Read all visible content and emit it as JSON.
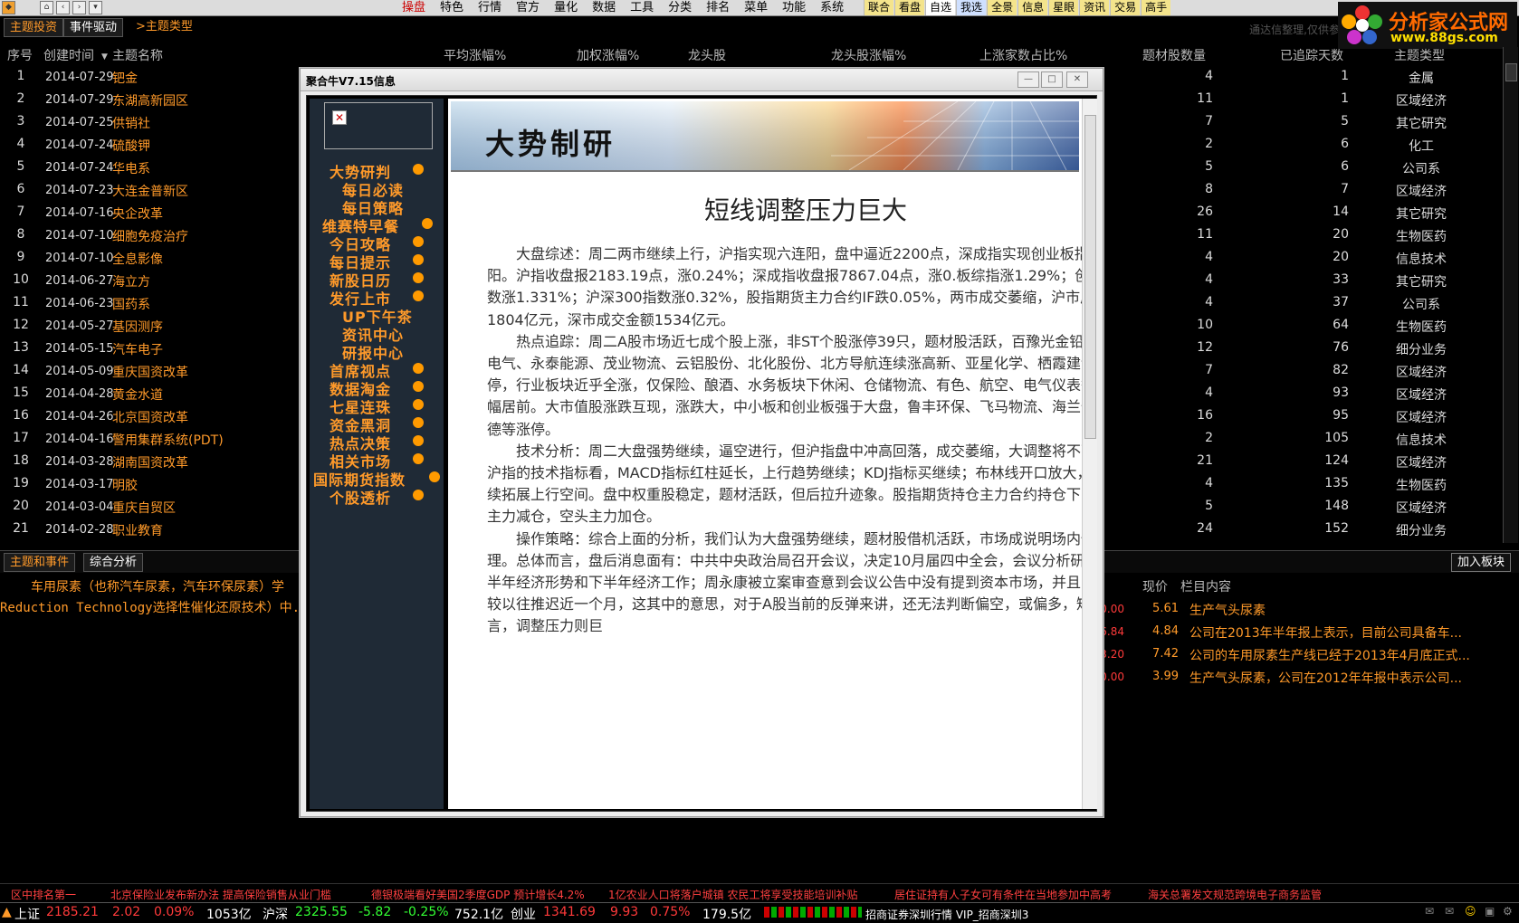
{
  "menubar": {
    "items": [
      "操盘",
      "特色",
      "行情",
      "官方",
      "量化",
      "数据",
      "工具",
      "分类",
      "排名",
      "菜单",
      "功能",
      "系统"
    ],
    "tools": [
      "联合",
      "看盘",
      "自选",
      "我选",
      "全景",
      "信息",
      "星眼",
      "资讯",
      "交易",
      "高手"
    ]
  },
  "subtabs": {
    "tab1": "主题投资",
    "tab2": "事件驱动",
    "link": ">主题类型",
    "source_note": "通达信整理,仅供参考（右键"
  },
  "logo": {
    "title": "分析家公式网",
    "url": "www.88gs.com"
  },
  "table": {
    "headers": [
      "序号",
      "创建时间",
      "主题名称",
      "平均涨幅%",
      "加权涨幅%",
      "龙头股",
      "龙头股涨幅%",
      "上涨家数占比%",
      "题材股数量",
      "已追踪天数",
      "主题类型"
    ],
    "rows": [
      {
        "idx": "1",
        "date": "2014-07-29",
        "name": "钯金",
        "count": "4",
        "days": "1",
        "type": "金属"
      },
      {
        "idx": "2",
        "date": "2014-07-29",
        "name": "东湖高新园区",
        "count": "11",
        "days": "1",
        "type": "区域经济"
      },
      {
        "idx": "3",
        "date": "2014-07-25",
        "name": "供销社",
        "count": "7",
        "days": "5",
        "type": "其它研究"
      },
      {
        "idx": "4",
        "date": "2014-07-24",
        "name": "硫酸钾",
        "count": "2",
        "days": "6",
        "type": "化工"
      },
      {
        "idx": "5",
        "date": "2014-07-24",
        "name": "华电系",
        "count": "5",
        "days": "6",
        "type": "公司系"
      },
      {
        "idx": "6",
        "date": "2014-07-23",
        "name": "大连金普新区",
        "count": "8",
        "days": "7",
        "type": "区域经济"
      },
      {
        "idx": "7",
        "date": "2014-07-16",
        "name": "央企改革",
        "count": "26",
        "days": "14",
        "type": "其它研究"
      },
      {
        "idx": "8",
        "date": "2014-07-10",
        "name": "细胞免疫治疗",
        "count": "11",
        "days": "20",
        "type": "生物医药"
      },
      {
        "idx": "9",
        "date": "2014-07-10",
        "name": "全息影像",
        "count": "4",
        "days": "20",
        "type": "信息技术"
      },
      {
        "idx": "10",
        "date": "2014-06-27",
        "name": "海立方",
        "count": "4",
        "days": "33",
        "type": "其它研究"
      },
      {
        "idx": "11",
        "date": "2014-06-23",
        "name": "国药系",
        "count": "4",
        "days": "37",
        "type": "公司系"
      },
      {
        "idx": "12",
        "date": "2014-05-27",
        "name": "基因测序",
        "count": "10",
        "days": "64",
        "type": "生物医药"
      },
      {
        "idx": "13",
        "date": "2014-05-15",
        "name": "汽车电子",
        "count": "12",
        "days": "76",
        "type": "细分业务"
      },
      {
        "idx": "14",
        "date": "2014-05-09",
        "name": "重庆国资改革",
        "count": "7",
        "days": "82",
        "type": "区域经济"
      },
      {
        "idx": "15",
        "date": "2014-04-28",
        "name": "黄金水道",
        "count": "4",
        "days": "93",
        "type": "区域经济"
      },
      {
        "idx": "16",
        "date": "2014-04-26",
        "name": "北京国资改革",
        "count": "16",
        "days": "95",
        "type": "区域经济"
      },
      {
        "idx": "17",
        "date": "2014-04-16",
        "name": "警用集群系统(PDT)",
        "count": "2",
        "days": "105",
        "type": "信息技术"
      },
      {
        "idx": "18",
        "date": "2014-03-28",
        "name": "湖南国资改革",
        "count": "21",
        "days": "124",
        "type": "区域经济"
      },
      {
        "idx": "19",
        "date": "2014-03-17",
        "name": "明胶",
        "count": "4",
        "days": "135",
        "type": "生物医药"
      },
      {
        "idx": "20",
        "date": "2014-03-04",
        "name": "重庆自贸区",
        "count": "5",
        "days": "148",
        "type": "区域经济"
      },
      {
        "idx": "21",
        "date": "2014-02-28",
        "name": "职业教育",
        "count": "24",
        "days": "152",
        "type": "细分业务"
      }
    ]
  },
  "bottom": {
    "tab1": "主题和事件",
    "tab2": "综合分析",
    "add_button": "加入板块",
    "desc_line1": "车用尿素（也称汽车尿素，汽车环保尿素）学",
    "desc_line2": "Reduction Technology选择性催化还原技术）中.",
    "stock_headers": [
      "幅%",
      "现价",
      "栏目内容"
    ],
    "stocks": [
      {
        "chg": "0.00",
        "price": "5.61",
        "col": "生产气头尿素"
      },
      {
        "chg": "6.84",
        "price": "4.84",
        "col": "公司在2013年半年报上表示，目前公司具备车..."
      },
      {
        "chg": "3.20",
        "price": "7.42",
        "col": "公司的车用尿素生产线已经于2013年4月底正式..."
      },
      {
        "chg": "0.00",
        "price": "3.99",
        "col": "生产气头尿素，公司在2012年年报中表示公司..."
      }
    ]
  },
  "ticker": [
    "区中排名第一",
    "北京保险业发布新办法 提高保险销售从业门槛",
    "德银极端看好美国2季度GDP 预计增长4.2%",
    "1亿农业人口将落户城镇 农民工将享受技能培训补贴",
    "居住证持有人子女可有条件在当地参加中高考",
    "海关总署发文规范跨境电子商务监管"
  ],
  "statusbar": {
    "sh_name": "上证",
    "sh_val": "2185.21",
    "sh_chg": "2.02",
    "sh_pct": "0.09%",
    "sh_amt": "1053亿",
    "hs_name": "沪深",
    "hs_val": "2325.55",
    "hs_chg": "-5.82",
    "hs_pct": "-0.25%",
    "hs_amt": "752.1亿",
    "cy_name": "创业",
    "cy_val": "1341.69",
    "cy_chg": "9.93",
    "cy_pct": "0.75%",
    "cy_amt": "179.5亿",
    "broker": "招商证券深圳行情 VIP_招商深圳3"
  },
  "dialog": {
    "title": "聚合牛V7.15信息",
    "nav": [
      "大势研判",
      "每日必读",
      "每日策略",
      "维赛特早餐",
      "今日攻略",
      "每日提示",
      "新股日历",
      "发行上市",
      "UP下午茶",
      "资讯中心",
      "研报中心",
      "首席视点",
      "数据淘金",
      "七星连珠",
      "资金黑洞",
      "热点决策",
      "相关市场",
      "国际期货指数",
      "个股透析"
    ],
    "banner_title": "大势制研",
    "article_title": "短线调整压力巨大",
    "paragraphs": [
      "大盘综述：周二两市继续上行，沪指实现六连阳，盘中逼近2200点，深成指实现创业板指三连阳。沪指收盘报2183.19点，涨0.24%；深成指收盘报7867.04点，涨0.板综指涨1.29%；创业板指数涨1.331%；沪深300指数涨0.32%，股指期货主力合约IF跌0.05%，两市成交萎缩，沪市成交金额1804亿元，深市成交金额1534亿元。",
      "热点追踪：周二A股市场近七成个股上涨，非ST个股涨停39只，题材股活跃，百豫光金铅、东北电气、永泰能源、茂业物流、云铝股份、北化股份、北方导航连续涨高新、亚星化学、栖霞建设等涨停，行业板块近乎全涨，仅保险、酿酒、水务板块下休闲、仓储物流、有色、航空、电气仪表等板块涨幅居前。大市值股涨跌互现，涨跌大，中小板和创业板强于大盘，鲁丰环保、飞马物流、海兰信、特锐德等涨停。",
      "技术分析：周二大盘强势继续，逼空进行，但沪指盘中冲高回落，成交萎缩，大调整将不可避免。沪指的技术指标看，MACD指标红柱延长，上行趋势继续；KDJ指标买继续；布林线开口放大，沪指继续拓展上行空间。盘中权重股稳定，题材活跃，但后拉升迹象。股指期货持仓主力合约持仓下降，多头主力减仓，空头主力加仓。",
      "操作策略：综合上面的分析，我们认为大盘强势继续，题材股借机活跃，市场成说明场内惜售心理。总体而言，盘后消息面有：中共中央政治局召开会议，决定10月届四中全会，会议分析研究了上半年经济形势和下半年经济工作；周永康被立案审查意到会议公告中没有提到资本市场，并且四中全会较以往推迟近一个月，这其中的意思，对于A股当前的反弹来讲，还无法判断偏空，或偏多，短线而言，调整压力则巨"
    ]
  }
}
